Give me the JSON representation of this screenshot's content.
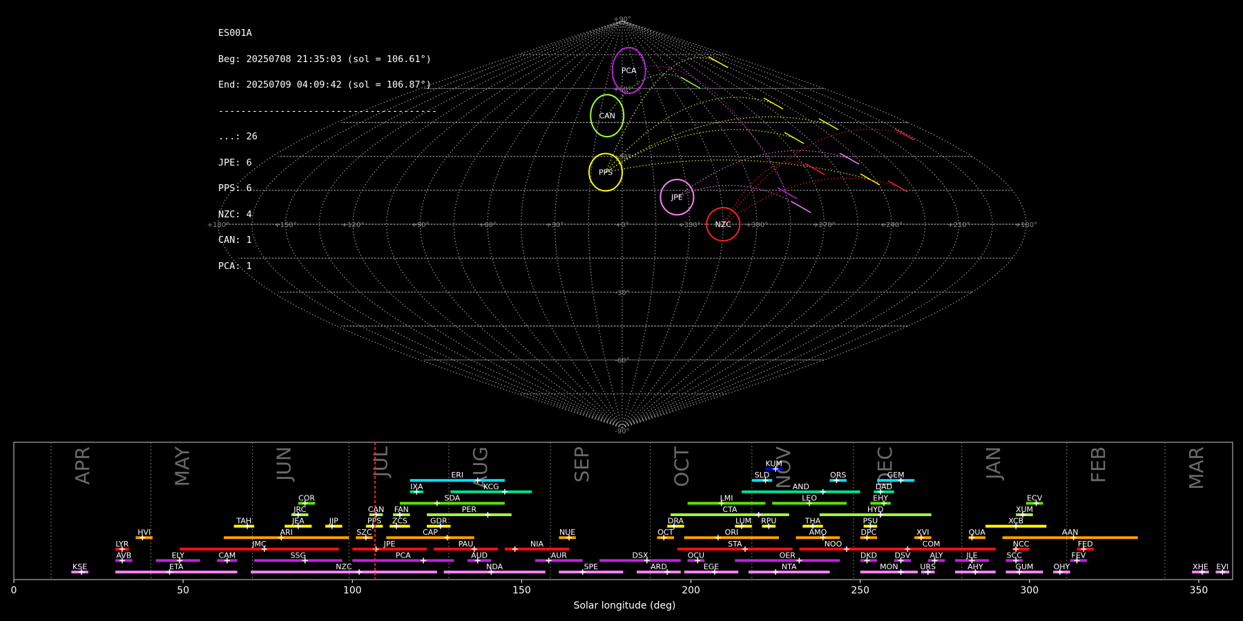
{
  "info": {
    "lines": [
      "ES001A",
      "Beg: 20250708 21:35:03 (sol = 106.61°)",
      "End: 20250709 04:09:42 (sol = 106.87°)",
      "---------------------------------------",
      "...: 26",
      "JPE: 6",
      "PPS: 6",
      "NZC: 4",
      "CAN: 1",
      "PCA: 1"
    ]
  },
  "chart_data": [
    {
      "type": "scatter",
      "projection": "sinusoidal sky map",
      "ra_tick_labels": [
        "+180°",
        "+150°",
        "+120°",
        "+90°",
        "+60°",
        "+30°",
        "+0°",
        "+330°",
        "+300°",
        "+270°",
        "+240°",
        "+210°",
        "+180°"
      ],
      "dec_tick_labels": [
        "+90°",
        "+60°",
        "+30°",
        "-30°",
        "-60°",
        "-90°"
      ],
      "radiants": [
        {
          "name": "PCA",
          "ra": 352,
          "dec": 68,
          "color": "#c020e0"
        },
        {
          "name": "CAN",
          "ra": 10,
          "dec": 48,
          "color": "#a0ff30"
        },
        {
          "name": "PPS",
          "ra": 8,
          "dec": 23,
          "color": "#ffff00"
        },
        {
          "name": "JPE",
          "ra": 335,
          "dec": 12,
          "color": "#ff80ff"
        },
        {
          "name": "NZC",
          "ra": 315,
          "dec": 0,
          "color": "#ff2020"
        }
      ]
    },
    {
      "type": "timeline",
      "xlabel": "Solar longitude (deg)",
      "xlim": [
        0,
        360
      ],
      "x_ticks": [
        0,
        50,
        100,
        150,
        200,
        250,
        300,
        350
      ],
      "current_sol": 106.7,
      "months": [
        {
          "name": "APR",
          "start": 11
        },
        {
          "name": "MAY",
          "start": 40.5
        },
        {
          "name": "JUN",
          "start": 70.5
        },
        {
          "name": "JUL",
          "start": 99
        },
        {
          "name": "AUG",
          "start": 128.5
        },
        {
          "name": "SEP",
          "start": 158.5
        },
        {
          "name": "OCT",
          "start": 188
        },
        {
          "name": "NOV",
          "start": 218
        },
        {
          "name": "DEC",
          "start": 248
        },
        {
          "name": "JAN",
          "start": 280
        },
        {
          "name": "FEB",
          "start": 311
        },
        {
          "name": "MAR",
          "start": 340
        }
      ],
      "showers": [
        {
          "code": "KUM",
          "start": 222,
          "end": 227,
          "peak": 225,
          "row": 8,
          "color": "#0000ff"
        },
        {
          "code": "ERI",
          "start": 117,
          "end": 145,
          "peak": 137,
          "row": 7,
          "color": "#00e0ff"
        },
        {
          "code": "SLD",
          "start": 218,
          "end": 224,
          "peak": 222,
          "row": 7,
          "color": "#00e0ff"
        },
        {
          "code": "ORS",
          "start": 241,
          "end": 246,
          "peak": 243,
          "row": 7,
          "color": "#00e0ff"
        },
        {
          "code": "GEM",
          "start": 255,
          "end": 266,
          "peak": 262,
          "row": 7,
          "color": "#00e0ff"
        },
        {
          "code": "IXA",
          "start": 117,
          "end": 121,
          "peak": 119,
          "row": 6,
          "color": "#00e090"
        },
        {
          "code": "KCG",
          "start": 129,
          "end": 153,
          "peak": 145,
          "row": 6,
          "color": "#00e090"
        },
        {
          "code": "AND",
          "start": 215,
          "end": 250,
          "peak": 239,
          "row": 6,
          "color": "#00e090"
        },
        {
          "code": "DAD",
          "start": 254,
          "end": 260,
          "peak": 256,
          "row": 6,
          "color": "#00e090"
        },
        {
          "code": "COR",
          "start": 84,
          "end": 89,
          "peak": 86,
          "row": 5,
          "color": "#60e000"
        },
        {
          "code": "SDA",
          "start": 114,
          "end": 145,
          "peak": 125,
          "row": 5,
          "color": "#60e000"
        },
        {
          "code": "LMI",
          "start": 199,
          "end": 222,
          "peak": 209,
          "row": 5,
          "color": "#60e000"
        },
        {
          "code": "LEO",
          "start": 224,
          "end": 246,
          "peak": 235,
          "row": 5,
          "color": "#60e000"
        },
        {
          "code": "EHY",
          "start": 253,
          "end": 259,
          "peak": 257,
          "row": 5,
          "color": "#60e000"
        },
        {
          "code": "ECV",
          "start": 299,
          "end": 304,
          "peak": 302,
          "row": 5,
          "color": "#60e000"
        },
        {
          "code": "JRC",
          "start": 82,
          "end": 87,
          "peak": 84,
          "row": 4,
          "color": "#a0ff30"
        },
        {
          "code": "CAN",
          "start": 105,
          "end": 109,
          "peak": 107,
          "row": 4,
          "color": "#a0ff30"
        },
        {
          "code": "FAN",
          "start": 112,
          "end": 117,
          "peak": 114,
          "row": 4,
          "color": "#a0ff30"
        },
        {
          "code": "PER",
          "start": 122,
          "end": 147,
          "peak": 140,
          "row": 4,
          "color": "#a0ff30"
        },
        {
          "code": "CTA",
          "start": 194,
          "end": 229,
          "peak": 220,
          "row": 4,
          "color": "#a0ff30"
        },
        {
          "code": "HYD",
          "start": 238,
          "end": 271,
          "peak": 256,
          "row": 4,
          "color": "#a0ff30"
        },
        {
          "code": "XUM",
          "start": 296,
          "end": 301,
          "peak": 298,
          "row": 4,
          "color": "#a0ff30"
        },
        {
          "code": "TAH",
          "start": 65,
          "end": 71,
          "peak": 69,
          "row": 3,
          "color": "#ffff00"
        },
        {
          "code": "JEA",
          "start": 80,
          "end": 88,
          "peak": 84,
          "row": 3,
          "color": "#ffff00"
        },
        {
          "code": "JIP",
          "start": 92,
          "end": 97,
          "peak": 94,
          "row": 3,
          "color": "#ffff00"
        },
        {
          "code": "PPS",
          "start": 104,
          "end": 109,
          "peak": 106,
          "row": 3,
          "color": "#ffff00"
        },
        {
          "code": "ZCS",
          "start": 111,
          "end": 117,
          "peak": 113,
          "row": 3,
          "color": "#ffff00"
        },
        {
          "code": "GDR",
          "start": 122,
          "end": 129,
          "peak": 126,
          "row": 3,
          "color": "#ffff00"
        },
        {
          "code": "DRA",
          "start": 193,
          "end": 198,
          "peak": 195,
          "row": 3,
          "color": "#ffff00"
        },
        {
          "code": "LUM",
          "start": 213,
          "end": 218,
          "peak": 215,
          "row": 3,
          "color": "#ffff00"
        },
        {
          "code": "RPU",
          "start": 221,
          "end": 225,
          "peak": 223,
          "row": 3,
          "color": "#ffff00"
        },
        {
          "code": "THA",
          "start": 233,
          "end": 239,
          "peak": 236,
          "row": 3,
          "color": "#ffff00"
        },
        {
          "code": "PSU",
          "start": 251,
          "end": 255,
          "peak": 253,
          "row": 3,
          "color": "#ffff00"
        },
        {
          "code": "XCB",
          "start": 287,
          "end": 305,
          "peak": 296,
          "row": 3,
          "color": "#ffff00"
        },
        {
          "code": "HVI",
          "start": 36,
          "end": 41,
          "peak": 38,
          "row": 2,
          "color": "#ffa000"
        },
        {
          "code": "ARI",
          "start": 62,
          "end": 99,
          "peak": 79,
          "row": 2,
          "color": "#ffa000"
        },
        {
          "code": "SZC",
          "start": 101,
          "end": 106,
          "peak": 104,
          "row": 2,
          "color": "#ffa000"
        },
        {
          "code": "CAP",
          "start": 110,
          "end": 136,
          "peak": 128,
          "row": 2,
          "color": "#ffa000"
        },
        {
          "code": "NUE",
          "start": 161,
          "end": 166,
          "peak": 164,
          "row": 2,
          "color": "#ffa000"
        },
        {
          "code": "OCT",
          "start": 190,
          "end": 195,
          "peak": 192,
          "row": 2,
          "color": "#ffa000"
        },
        {
          "code": "ORI",
          "start": 198,
          "end": 226,
          "peak": 208,
          "row": 2,
          "color": "#ffa000"
        },
        {
          "code": "AMO",
          "start": 231,
          "end": 244,
          "peak": 239,
          "row": 2,
          "color": "#ffa000"
        },
        {
          "code": "DPC",
          "start": 250,
          "end": 255,
          "peak": 252,
          "row": 2,
          "color": "#ffa000"
        },
        {
          "code": "XVI",
          "start": 266,
          "end": 271,
          "peak": 268,
          "row": 2,
          "color": "#ffa000"
        },
        {
          "code": "QUA",
          "start": 282,
          "end": 287,
          "peak": 283,
          "row": 2,
          "color": "#ffa000"
        },
        {
          "code": "AAN",
          "start": 292,
          "end": 332,
          "peak": 313,
          "row": 2,
          "color": "#ffa000"
        },
        {
          "code": "LYR",
          "start": 30,
          "end": 34,
          "peak": 32,
          "row": 1,
          "color": "#ff1010"
        },
        {
          "code": "JMC",
          "start": 49,
          "end": 96,
          "peak": 74,
          "row": 1,
          "color": "#ff1010"
        },
        {
          "code": "JPE",
          "start": 100,
          "end": 122,
          "peak": 107,
          "row": 1,
          "color": "#ff1010"
        },
        {
          "code": "PAU",
          "start": 124,
          "end": 143,
          "peak": 136,
          "row": 1,
          "color": "#ff1010"
        },
        {
          "code": "NIA",
          "start": 145,
          "end": 164,
          "peak": 148,
          "row": 1,
          "color": "#ff1010"
        },
        {
          "code": "STA",
          "start": 196,
          "end": 230,
          "peak": 216,
          "row": 1,
          "color": "#ff1010"
        },
        {
          "code": "NOO",
          "start": 232,
          "end": 252,
          "peak": 246,
          "row": 1,
          "color": "#ff1010"
        },
        {
          "code": "COM",
          "start": 252,
          "end": 290,
          "peak": 264,
          "row": 1,
          "color": "#ff1010"
        },
        {
          "code": "NCC",
          "start": 295,
          "end": 300,
          "peak": 296,
          "row": 1,
          "color": "#ff1010"
        },
        {
          "code": "FED",
          "start": 314,
          "end": 319,
          "peak": 316,
          "row": 1,
          "color": "#ff1010"
        },
        {
          "code": "AVB",
          "start": 30,
          "end": 35,
          "peak": 32,
          "row": 0,
          "color": "#c020e0"
        },
        {
          "code": "ELY",
          "start": 42,
          "end": 55,
          "peak": 49,
          "row": 0,
          "color": "#c020e0"
        },
        {
          "code": "CAM",
          "start": 60,
          "end": 66,
          "peak": 63,
          "row": 0,
          "color": "#c020e0"
        },
        {
          "code": "SSG",
          "start": 71,
          "end": 97,
          "peak": 86,
          "row": 0,
          "color": "#c020e0"
        },
        {
          "code": "PCA",
          "start": 100,
          "end": 130,
          "peak": 121,
          "row": 0,
          "color": "#c020e0"
        },
        {
          "code": "AUD",
          "start": 134,
          "end": 141,
          "peak": 137,
          "row": 0,
          "color": "#c020e0"
        },
        {
          "code": "AUR",
          "start": 154,
          "end": 168,
          "peak": 158,
          "row": 0,
          "color": "#c020e0"
        },
        {
          "code": "DSX",
          "start": 173,
          "end": 197,
          "peak": 187,
          "row": 0,
          "color": "#c020e0"
        },
        {
          "code": "OCU",
          "start": 199,
          "end": 204,
          "peak": 202,
          "row": 0,
          "color": "#c020e0"
        },
        {
          "code": "OER",
          "start": 213,
          "end": 244,
          "peak": 232,
          "row": 0,
          "color": "#c020e0"
        },
        {
          "code": "DKD",
          "start": 250,
          "end": 255,
          "peak": 252,
          "row": 0,
          "color": "#c020e0"
        },
        {
          "code": "DSV",
          "start": 260,
          "end": 265,
          "peak": 262,
          "row": 0,
          "color": "#c020e0"
        },
        {
          "code": "ALY",
          "start": 270,
          "end": 275,
          "peak": 272,
          "row": 0,
          "color": "#c020e0"
        },
        {
          "code": "JLE",
          "start": 278,
          "end": 288,
          "peak": 283,
          "row": 0,
          "color": "#c020e0"
        },
        {
          "code": "SCC",
          "start": 293,
          "end": 298,
          "peak": 296,
          "row": 0,
          "color": "#c020e0"
        },
        {
          "code": "FEV",
          "start": 312,
          "end": 317,
          "peak": 314,
          "row": 0,
          "color": "#c020e0"
        },
        {
          "code": "KSE",
          "start": 17,
          "end": 22,
          "peak": 20,
          "row": -1,
          "color": "#ff80ff"
        },
        {
          "code": "ETA",
          "start": 30,
          "end": 66,
          "peak": 46,
          "row": -1,
          "color": "#ff80ff"
        },
        {
          "code": "NZC",
          "start": 70,
          "end": 125,
          "peak": 102,
          "row": -1,
          "color": "#ff80ff"
        },
        {
          "code": "NDA",
          "start": 127,
          "end": 157,
          "peak": 141,
          "row": -1,
          "color": "#ff80ff"
        },
        {
          "code": "SPE",
          "start": 161,
          "end": 180,
          "peak": 168,
          "row": -1,
          "color": "#ff80ff"
        },
        {
          "code": "ARD",
          "start": 184,
          "end": 197,
          "peak": 193,
          "row": -1,
          "color": "#ff80ff"
        },
        {
          "code": "EGE",
          "start": 198,
          "end": 214,
          "peak": 207,
          "row": -1,
          "color": "#ff80ff"
        },
        {
          "code": "NTA",
          "start": 217,
          "end": 241,
          "peak": 225,
          "row": -1,
          "color": "#ff80ff"
        },
        {
          "code": "MON",
          "start": 250,
          "end": 267,
          "peak": 262,
          "row": -1,
          "color": "#ff80ff"
        },
        {
          "code": "URS",
          "start": 268,
          "end": 272,
          "peak": 270,
          "row": -1,
          "color": "#ff80ff"
        },
        {
          "code": "AHY",
          "start": 278,
          "end": 290,
          "peak": 284,
          "row": -1,
          "color": "#ff80ff"
        },
        {
          "code": "GUM",
          "start": 293,
          "end": 304,
          "peak": 297,
          "row": -1,
          "color": "#ff80ff"
        },
        {
          "code": "OHY",
          "start": 307,
          "end": 312,
          "peak": 309,
          "row": -1,
          "color": "#ff80ff"
        },
        {
          "code": "XHE",
          "start": 348,
          "end": 353,
          "peak": 351,
          "row": -1,
          "color": "#ff80ff"
        },
        {
          "code": "EVI",
          "start": 355,
          "end": 359,
          "peak": 357,
          "row": -1,
          "color": "#ff80ff"
        }
      ]
    }
  ]
}
